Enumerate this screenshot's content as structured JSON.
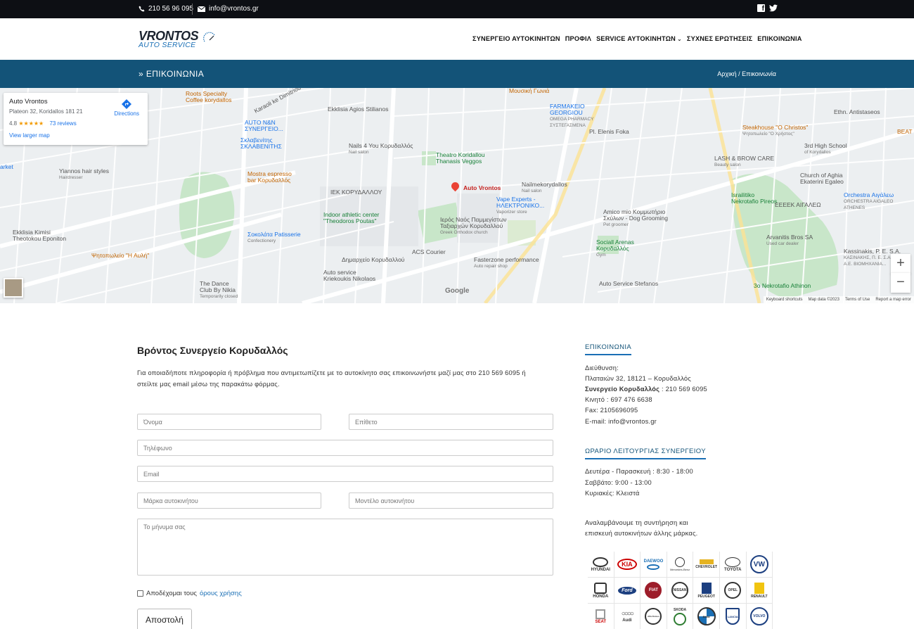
{
  "topbar": {
    "phone": "210 56 96 095",
    "email": "info@vrontos.gr",
    "social": [
      "facebook-icon",
      "twitter-icon"
    ]
  },
  "header": {
    "logo_line1": "VRONTOS",
    "logo_line2": "AUTO SERVICE",
    "nav": [
      "ΣΥΝΕΡΓΕΙΟ ΑΥΤΟΚΙΝΗΤΩΝ",
      "ΠΡΟΦΙΛ",
      "SERVICE ΑΥΤΟΚΙΝΗΤΩΝ",
      "ΣΥΧΝΕΣ ΕΡΩΤΗΣΕΙΣ",
      "ΕΠΙΚΟΙΝΩΝΙΑ"
    ]
  },
  "titlebar": {
    "title": "ΕΠΙΚΟΙΝΩΝΙΑ",
    "breadcrumb": "Αρχική / Επικοινωνία"
  },
  "map": {
    "card": {
      "name": "Auto Vrontos",
      "address": "Plateon 32, Koridallos 181 21",
      "rating": "4.8",
      "stars": "★★★★★",
      "reviews": "73 reviews",
      "larger_map": "View larger map",
      "directions": "Directions"
    },
    "labels": {
      "roots": "Roots Specialty",
      "roots2": "Coffee korydallos",
      "karaoli": "Karaoli ke Dimitriou",
      "agios": "Ekklisia Agios Stilianos",
      "mousiki": "Μουσική Γωνιά",
      "farmakeio": "FARMAKEIO",
      "georgiou": "GEORGIOU",
      "omega": "OMEGA PHARMACY",
      "systegasmena": "ΣΥΣΤΕΓΑΣΜΕΝΑ",
      "elenis": "Pl. Elenis Foka",
      "steakhouse": "Steakhouse \"O Christos\"",
      "steakhouse2": "Ψητοπωλείο \"Ο Χρήστος\"",
      "ethn": "Ethn. Antistaseos",
      "auto_nn": "AUTO N&N",
      "auto_nn2": "ΣΥΝΕΡΓΕΙΟ...",
      "sklavenitis": "Σκλαβενίτης",
      "sklavenitis2": "ΣΚΛΑΒΕΝΙΤΗΣ",
      "nails4you": "Nails 4 You Κορυδαλλός",
      "nails4you2": "Nail salon",
      "theatro": "Theatro Koridallou",
      "theatro2": "Thanasis Veggos",
      "school3": "3rd High School",
      "school3b": "of Korydallos",
      "lash": "LASH & BROW CARE",
      "lash2": "Beauty salon",
      "agiaekaterini": "Church of Aghia",
      "agiaekaterini2": "Ekaterini Egaleo",
      "yiannos": "Yiannos hair styles",
      "yiannos2": "Hairdresser",
      "mostra": "Mostra espresso",
      "mostra2": "bar Κορυδαλλός",
      "iek": "ΙΕΚ ΚΟΡΥΔΑΛΛΟΥ",
      "auto_vrontos": "Auto Vrontos",
      "vape": "Vape Experts -",
      "vape2": "ΗΛΕΚΤΡΟΝΙΚΟ...",
      "vape3": "Vaporizer store",
      "nailmekorydallos": "Nailmekorydallos",
      "nailmekorydallos2": "Nail salon",
      "isralitiko": "Israilitiko",
      "isralitiko2": "Nekrotafio Pireos",
      "eeeek": "ΕΕΕΕΚ ΑΙΓΑΛΕΩ",
      "orchestra": "Orchestra Αιγάλεω",
      "orchestra2": "ORCHESTRA AIGALEO",
      "orchestra3": "ATHENES",
      "market": "arket",
      "indoor": "Indoor athletic center",
      "indoor2": "\"Theodoros Poutas\"",
      "ieros": "Ιερός Ναός Παμμεγίστων",
      "ieros2": "Ταξιαρχών Κορυδαλλού",
      "ieros3": "Greek Orthodox church",
      "amico": "Amico mio Κομμωτήριο",
      "amico2": "Σκύλων - Dog Grooming",
      "amico3": "Pet groomer",
      "ekklisia": "Ekklisia Kimisi",
      "ekklisia2": "Theotokou Eponiton",
      "sokolata": "Σοκολάτα Patisserie",
      "sokolata2": "Confectionery",
      "sociall": "Sociall Arenas",
      "sociall2": "Κορυδαλλός",
      "sociall3": "Gym",
      "arvanitis": "Arvanitis Bros SA",
      "arvanitis2": "Used car dealer",
      "kassinakis": "Kassinakis, P. E. S.A.",
      "kassinakis2": "ΚΑΣΙΝΑΚΗΣ, Π. Ε. Σ.Α.",
      "kassinakis3": "Α.Ε. ΒΙΟΜΗΧΑΝΙΑ...",
      "psitopoleio": "Ψητοπωλείο \"Η Αυλή\"",
      "dimarxeio": "Δημαρχείο Κορυδαλλού",
      "acs": "ACS Courier",
      "fasterzone": "Fasterzone performance",
      "fasterzone2": "Auto repair shop",
      "autoservice": "Auto service",
      "autoservice2": "Kriekoukis Nikolaos",
      "dance": "The Dance",
      "dance2": "Club By Nikia",
      "dance3": "Temporarily closed",
      "stefanos": "Auto Service Stefanos",
      "nekrotafio3": "3o Nekrotafio Athinon",
      "beat": "BEAT"
    },
    "google": "Google",
    "footer": [
      "Keyboard shortcuts",
      "Map data ©2023",
      "Terms of Use",
      "Report a map error"
    ]
  },
  "main": {
    "heading": "Βρόντος Συνεργείο Κορυδαλλός",
    "intro": "Για οποιαδήποτε πληροφορία ή πρόβλημα που αντιμετωπίζετε με το αυτοκίνητο σας επικοινωνήστε μαζί μας στο 210 569 6095 ή στείλτε μας email μέσω της παρακάτω φόρμας.",
    "form": {
      "first_name": "Όνομα",
      "last_name": "Επίθετο",
      "phone": "Τηλέφωνο",
      "email": "Email",
      "brand": "Μάρκα αυτοκινήτου",
      "model": "Μοντέλο αυτοκινήτου",
      "message": "Το μήνυμα σας",
      "terms_prefix": "Αποδέχομαι τους",
      "terms_link": "όρους χρήσης",
      "submit": "Αποστολή"
    }
  },
  "sidebar": {
    "contact_heading": "ΕΠΙΚΟΙΝΩΝΙΑ",
    "address_label": "Διεύθυνση:",
    "address": "Πλαταιών 32, 18121 – Κορυδαλλός",
    "workshop_label": "Συνεργείο Κορυδαλλός",
    "workshop_phone": ": 210 569 6095",
    "mobile": "Κινητό : 697 476 6638",
    "fax": "Fax: 2105696095",
    "email": "E-mail: info@vrontos.gr",
    "hours_heading": "ΩΡΑΡΙΟ ΛΕΙΤΟΥΡΓΙΑΣ ΣΥΝΕΡΓΕΙΟΥ",
    "hours": [
      "Δευτέρα - Παρασκευή : 8:30 - 18:00",
      "Σαββάτο: 9:00 - 13:00",
      "Κυριακές: Κλειστά"
    ],
    "brands_text": [
      "Αναλαμβάνουμε τη συντήρηση και",
      "επισκευή αυτοκινήτων άλλης μάρκας."
    ],
    "brands": [
      "HYUNDAI",
      "KIA",
      "DAEWOO",
      "Mercedes-Benz",
      "CHEVROLET",
      "TOYOTA",
      "VW",
      "HONDA",
      "Ford",
      "FIAT",
      "NISSAN",
      "PEUGEOT",
      "OPEL",
      "RENAULT",
      "SEAT",
      "Audi",
      "Alfa Romeo",
      "SKODA",
      "BMW",
      "LANCIA",
      "VOLVO"
    ]
  },
  "colors": {
    "topbar_bg": "#0d0f14",
    "title_bg": "#135378",
    "accent": "#1a6fb5"
  }
}
